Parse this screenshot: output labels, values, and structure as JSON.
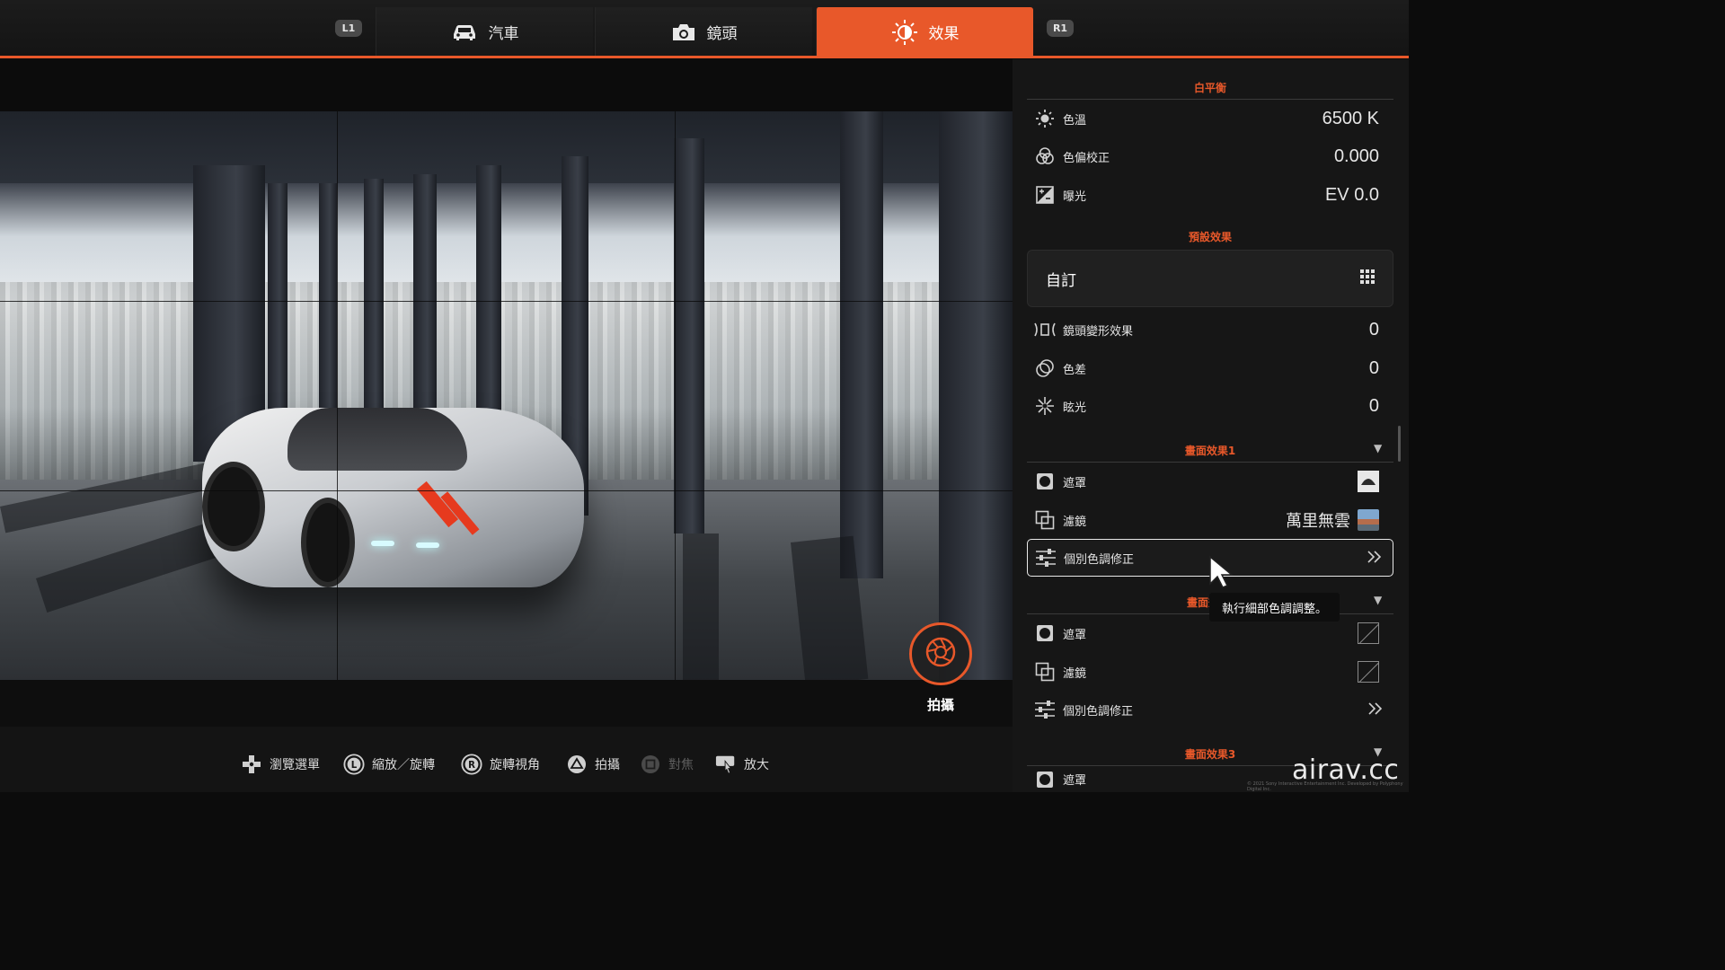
{
  "tabs": {
    "left_shoulder": "L1",
    "right_shoulder": "R1",
    "items": [
      {
        "label": "汽車",
        "icon": "car-icon",
        "active": false
      },
      {
        "label": "鏡頭",
        "icon": "camera-icon",
        "active": false
      },
      {
        "label": "效果",
        "icon": "brightness-icon",
        "active": true
      }
    ]
  },
  "viewport": {
    "capture_label": "拍攝"
  },
  "hints": [
    {
      "label": "瀏覽選單",
      "icon": "dpad-icon",
      "enabled": true
    },
    {
      "label": "縮放／旋轉",
      "icon": "left-stick-icon",
      "glyph": "L",
      "enabled": true
    },
    {
      "label": "旋轉視角",
      "icon": "right-stick-icon",
      "glyph": "R",
      "enabled": true
    },
    {
      "label": "拍攝",
      "icon": "triangle-button-icon",
      "enabled": true
    },
    {
      "label": "對焦",
      "icon": "square-button-icon",
      "enabled": false
    },
    {
      "label": "放大",
      "icon": "touchpad-icon",
      "enabled": true
    }
  ],
  "panel": {
    "white_balance": {
      "title": "白平衡",
      "rows": [
        {
          "label": "色溫",
          "value": "6500 K",
          "icon": "sun-icon"
        },
        {
          "label": "色偏校正",
          "value": "0.000",
          "icon": "color-circles-icon"
        },
        {
          "label": "曝光",
          "value": "EV 0.0",
          "icon": "exposure-icon"
        }
      ]
    },
    "preset": {
      "title": "預設效果",
      "value": "自訂",
      "icon": "grid-menu-icon"
    },
    "lens_rows": [
      {
        "label": "鏡頭變形效果",
        "value": "0",
        "icon": "lens-distortion-icon"
      },
      {
        "label": "色差",
        "value": "0",
        "icon": "chromatic-aberration-icon"
      },
      {
        "label": "眩光",
        "value": "0",
        "icon": "glare-icon"
      }
    ],
    "screen_effect_1": {
      "title": "畫面效果1",
      "mask_label": "遮罩",
      "filter_label": "濾鏡",
      "filter_value": "萬里無雲",
      "color_adjust_label": "個別色調修正"
    },
    "screen_effect_2": {
      "title": "畫面效",
      "mask_label": "遮罩",
      "filter_label": "濾鏡",
      "color_adjust_label": "個別色調修正"
    },
    "screen_effect_3": {
      "title": "畫面效果3",
      "mask_label": "遮罩"
    },
    "tooltip": "執行細部色調調整。"
  },
  "watermark": "airav.cc",
  "copyright": "© 2021 Sony Interactive Entertainment Inc. Developed by Polyphony Digital Inc.",
  "colors": {
    "accent": "#e8582a",
    "panel_bg": "#161616",
    "stripe": "#e63a1e"
  }
}
